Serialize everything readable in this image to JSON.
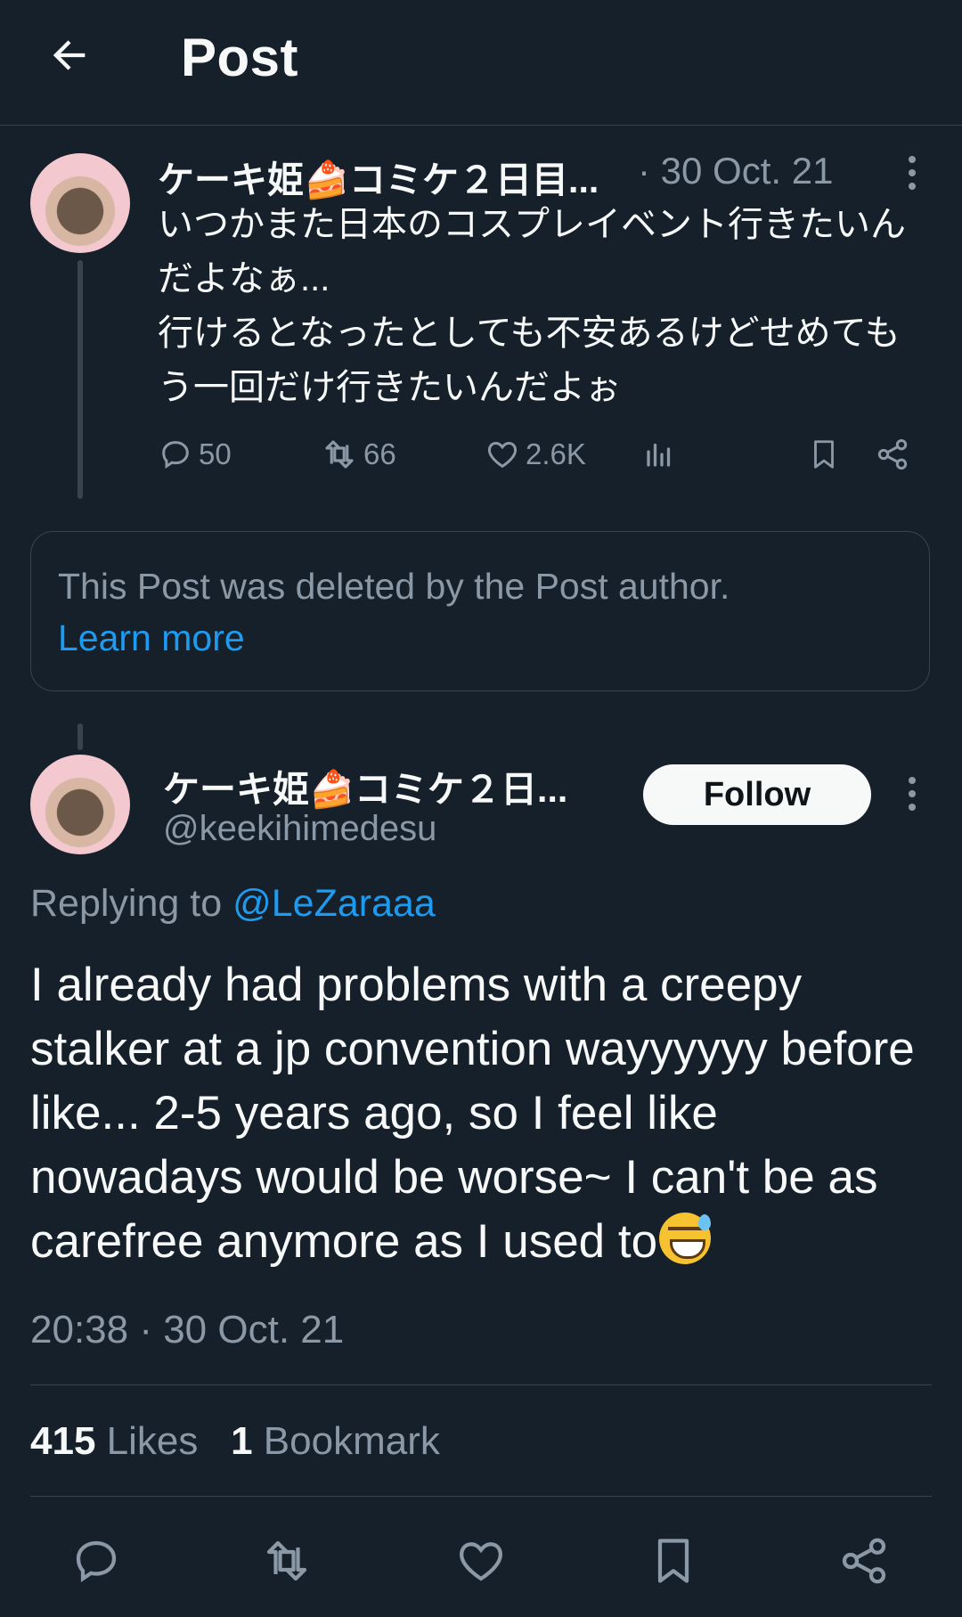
{
  "header": {
    "title": "Post"
  },
  "parent_post": {
    "display_name": "ケーキ姫🍰コミケ２日目...",
    "timestamp": "· 30 Oct. 21",
    "text": "いつかまた日本のコスプレイベント行きたいんだよなぁ...\n行けるとなったとしても不安あるけどせめてもう一回だけ行きたいんだよぉ",
    "actions": {
      "replies": "50",
      "reposts": "66",
      "likes": "2.6K"
    }
  },
  "deleted_notice": {
    "text": "This Post was deleted by the Post author.",
    "link": "Learn more"
  },
  "main_post": {
    "display_name": "ケーキ姫🍰コミケ２日...",
    "handle": "@keekihimedesu",
    "follow_label": "Follow",
    "replying_prefix": "Replying to",
    "replying_handle": "@LeZaraaa",
    "text": "I already had problems with a  creepy stalker at a jp convention wayyyyyy before like... 2-5 years ago, so I feel like nowadays would be worse~ I can't be as carefree anymore as I used to",
    "emoji": "sweat-smile-emoji",
    "timestamp": "20:38 · 30 Oct. 21",
    "stats": {
      "likes_count": "415",
      "likes_label": "Likes",
      "bookmarks_count": "1",
      "bookmarks_label": "Bookmark"
    }
  },
  "icons": {
    "back": "arrow-left-icon",
    "more": "more-vertical-icon",
    "reply": "reply-icon",
    "repost": "repost-icon",
    "like": "heart-icon",
    "views": "analytics-icon",
    "bookmark": "bookmark-icon",
    "share": "share-icon"
  },
  "colors": {
    "background": "#15202b",
    "accent": "#1d9bf0",
    "muted": "#8b98a5",
    "border": "#38444d"
  }
}
